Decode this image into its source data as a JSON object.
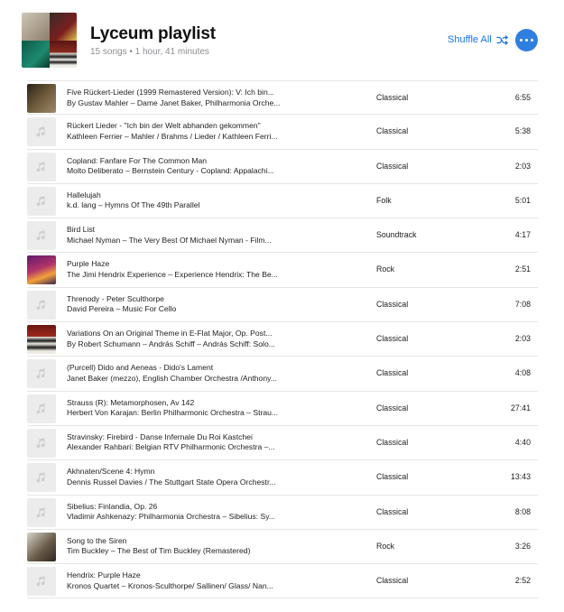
{
  "playlist": {
    "title": "Lyceum playlist",
    "summary": "15 songs • 1 hour, 41 minutes",
    "shuffle_label": "Shuffle All",
    "accent_color": "#1a73e8"
  },
  "tracks": [
    {
      "title": "Five Rückert-Lieder (1999 Remastered Version): V: Ich bin...",
      "subtitle": "By Gustav Mahler – Dame Janet Baker, Philharmonia Orche...",
      "genre": "Classical",
      "duration": "6:55",
      "artwork": "mahler"
    },
    {
      "title": "Rückert Lieder - \"Ich bin der Welt abhanden gekommen\"",
      "subtitle": "Kathleen Ferrier – Mahler / Brahms / Lieder / Kathleen Ferri...",
      "genre": "Classical",
      "duration": "5:38",
      "artwork": "placeholder"
    },
    {
      "title": "Copland: Fanfare For The Common Man",
      "subtitle": "Molto Deliberato – Bernstein Century - Copland: Appalachi...",
      "genre": "Classical",
      "duration": "2:03",
      "artwork": "placeholder"
    },
    {
      "title": "Hallelujah",
      "subtitle": "k.d. lang – Hymns Of The 49th Parallel",
      "genre": "Folk",
      "duration": "5:01",
      "artwork": "placeholder"
    },
    {
      "title": "Bird List",
      "subtitle": "Michael Nyman – The Very Best Of Michael Nyman - Film...",
      "genre": "Soundtrack",
      "duration": "4:17",
      "artwork": "placeholder"
    },
    {
      "title": "Purple Haze",
      "subtitle": "The Jimi Hendrix Experience – Experience Hendrix: The Be...",
      "genre": "Rock",
      "duration": "2:51",
      "artwork": "hendrix"
    },
    {
      "title": "Threnody - Peter Sculthorpe",
      "subtitle": "David Pereira – Music For Cello",
      "genre": "Classical",
      "duration": "7:08",
      "artwork": "placeholder"
    },
    {
      "title": "Variations On an Original Theme in E-Flat Major, Op. Post...",
      "subtitle": "By Robert Schumann – András Schiff – András Schiff: Solo...",
      "genre": "Classical",
      "duration": "2:03",
      "artwork": "schumann"
    },
    {
      "title": "(Purcell) Dido and Aeneas - Dido's Lament",
      "subtitle": "Janet Baker (mezzo), English Chamber Orchestra /Anthony...",
      "genre": "Classical",
      "duration": "4:08",
      "artwork": "placeholder"
    },
    {
      "title": "Strauss (R): Metamorphosen, Av 142",
      "subtitle": "Herbert Von Karajan: Berlin Philharmonic Orchestra – Strau...",
      "genre": "Classical",
      "duration": "27:41",
      "artwork": "placeholder"
    },
    {
      "title": "Stravinsky: Firebird - Danse Infernale Du Roi Kastchei",
      "subtitle": "Alexander Rahbari: Belgian RTV Philharmonic Orchestra –...",
      "genre": "Classical",
      "duration": "4:40",
      "artwork": "placeholder"
    },
    {
      "title": "Akhnaten/Scene 4: Hymn",
      "subtitle": "Dennis Russel Davies / The Stuttgart State Opera Orchestr...",
      "genre": "Classical",
      "duration": "13:43",
      "artwork": "placeholder"
    },
    {
      "title": "Sibelius: Finlandia, Op. 26",
      "subtitle": "Vladimir Ashkenazy: Philharmonia Orchestra – Sibelius: Sy...",
      "genre": "Classical",
      "duration": "8:08",
      "artwork": "placeholder"
    },
    {
      "title": "Song to the Siren",
      "subtitle": "Tim Buckley – The Best of Tim Buckley (Remastered)",
      "genre": "Rock",
      "duration": "3:26",
      "artwork": "buckley"
    },
    {
      "title": "Hendrix: Purple Haze",
      "subtitle": "Kronos Quartet – Kronos-Sculthorpe/ Sallinen/ Glass/ Nan...",
      "genre": "Classical",
      "duration": "2:52",
      "artwork": "placeholder"
    }
  ]
}
